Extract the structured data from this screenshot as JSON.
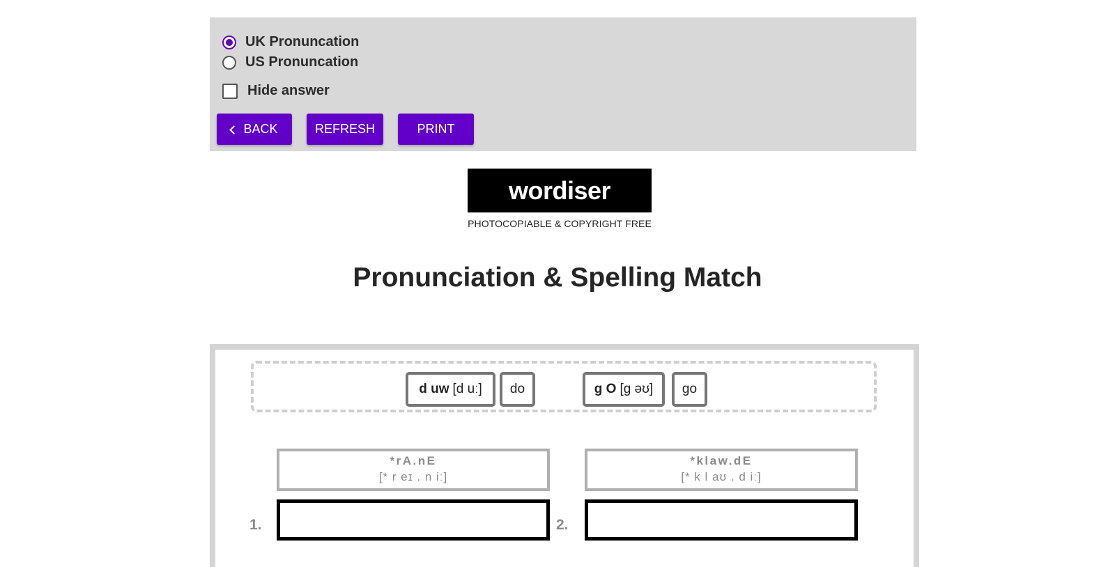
{
  "controls": {
    "radio_uk_label": "UK Pronuncation",
    "radio_us_label": "US Pronuncation",
    "selected": "UK Pronuncation",
    "hide_answer_label": "Hide answer",
    "hide_answer_checked": false,
    "back_label": "BACK",
    "refresh_label": "REFRESH",
    "print_label": "PRINT"
  },
  "logo": {
    "text": "wordiser",
    "tagline": "PHOTOCOPIABLE & COPYRIGHT FREE"
  },
  "title": "Pronunciation & Spelling Match",
  "examples": [
    {
      "pron": "d uw",
      "ipa": "[d uː]",
      "spelling": "do"
    },
    {
      "pron": "g O",
      "ipa": "[g əʊ]",
      "spelling": "go"
    }
  ],
  "questions": [
    {
      "number": "1.",
      "pron": "*rA.nE",
      "ipa": "[* r eɪ . n iː]",
      "answer": ""
    },
    {
      "number": "2.",
      "pron": "*klaw.dE",
      "ipa": "[* k l aʊ . d iː]",
      "answer": ""
    }
  ],
  "colors": {
    "accent": "#6200c9",
    "panel_bg": "#d8d8d8"
  }
}
